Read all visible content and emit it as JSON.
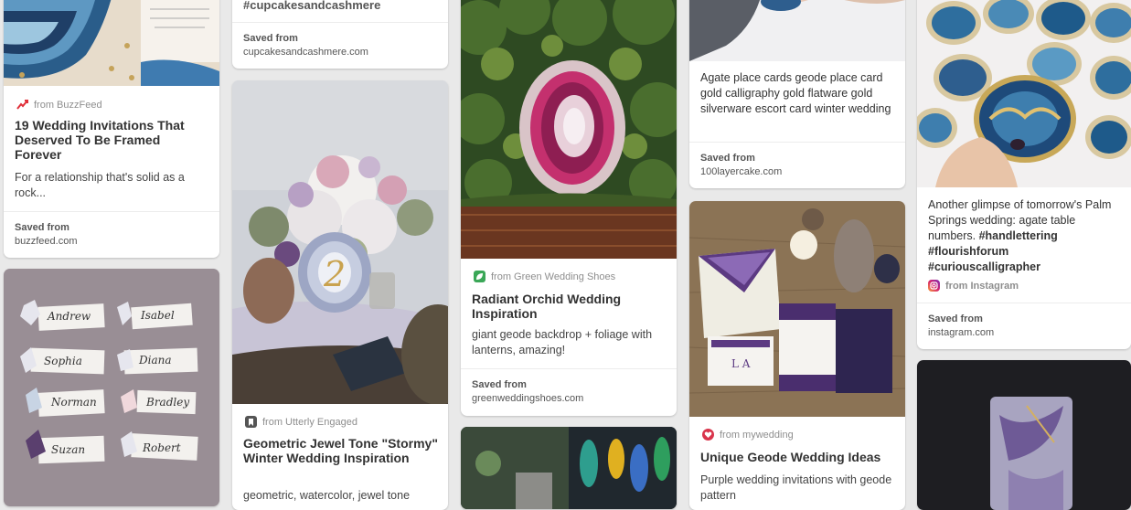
{
  "column1": {
    "pin1": {
      "source": "from BuzzFeed",
      "title": "19 Wedding Invitations That Deserved To Be Framed Forever",
      "description": "For a relationship that's solid as a rock...",
      "saved_label": "Saved from",
      "saved_domain": "buzzfeed.com",
      "icon": "trending-arrow-icon"
    },
    "pin2": {
      "image": "crystal-place-cards-photo",
      "card_names": [
        "Andrew",
        "Isabel",
        "Sophia",
        "Diana",
        "Norman",
        "Bradley",
        "Suzan",
        "Robert"
      ]
    }
  },
  "column2": {
    "pin1": {
      "title_partial": "#cupcakesandcashmere",
      "saved_label": "Saved from",
      "saved_domain": "cupcakesandcashmere.com"
    },
    "pin2": {
      "source": "from Utterly Engaged",
      "title": "Geometric Jewel Tone \"Stormy\" Winter Wedding Inspiration",
      "description_partial": "geometric, watercolor, jewel tone",
      "image_number": "2",
      "icon": "bookmark-icon"
    }
  },
  "column3": {
    "pin1": {
      "source": "from Green Wedding Shoes",
      "title": "Radiant Orchid Wedding Inspiration",
      "description": "giant geode backdrop + foliage with lanterns, amazing!",
      "saved_label": "Saved from",
      "saved_domain": "greenweddingshoes.com",
      "icon": "green-leaf-icon"
    },
    "pin2": {
      "image": "agate-wedding-collage-photo"
    }
  },
  "column4": {
    "pin1": {
      "description": "Agate place cards geode place card gold calligraphy gold flatware gold silverware escort card winter wedding",
      "saved_label": "Saved from",
      "saved_domain": "100layercake.com"
    },
    "pin2": {
      "source": "from mywedding",
      "title": "Unique Geode Wedding Ideas",
      "description_partial": "Purple wedding invitations with geode pattern",
      "icon": "heart-icon"
    }
  },
  "column5": {
    "pin1": {
      "description_text": "Another glimpse of tomorrow's Palm Springs wedding: agate table numbers.",
      "hashtags": [
        "#handlettering",
        "#flourishforum",
        "#curiouscalligrapher"
      ],
      "source": "from Instagram",
      "saved_label": "Saved from",
      "saved_domain": "instagram.com",
      "icon": "instagram-icon"
    },
    "pin2": {
      "image": "purple-agate-cake-photo"
    }
  }
}
